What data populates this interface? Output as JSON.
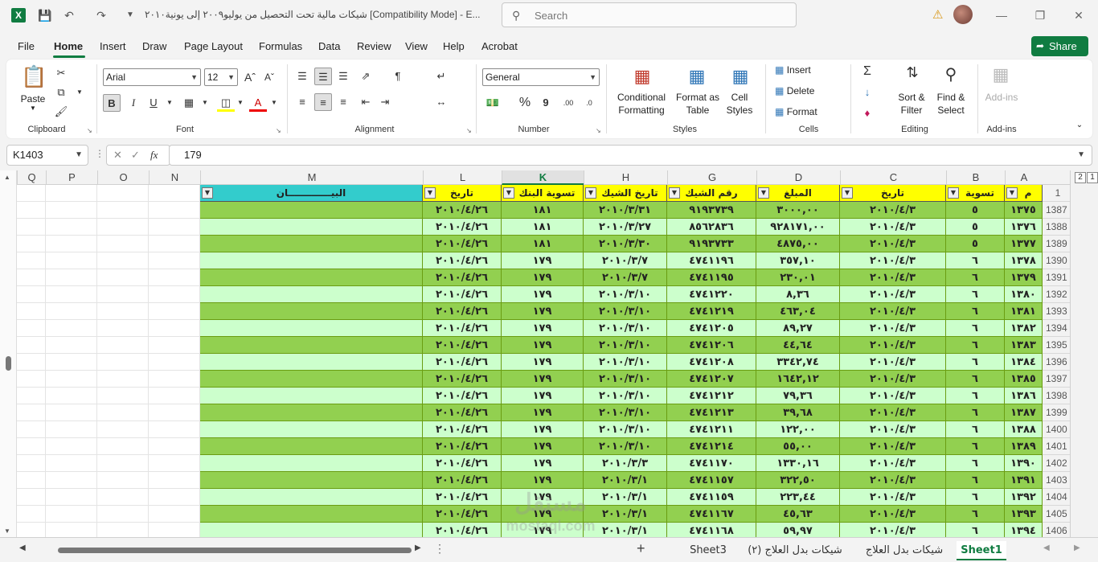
{
  "titlebar": {
    "app_logo": "X",
    "doc_title": "شيكات مالية تحت التحصيل من يوليو٢٠٠٩ إلى يونية٢٠١٠  [Compatibility Mode]  -  E...",
    "search_placeholder": "Search"
  },
  "menu": {
    "items": [
      "File",
      "Home",
      "Insert",
      "Draw",
      "Page Layout",
      "Formulas",
      "Data",
      "Review",
      "View",
      "Help",
      "Acrobat"
    ],
    "share": "Share"
  },
  "ribbon": {
    "clipboard": {
      "paste": "Paste",
      "label": "Clipboard"
    },
    "font": {
      "name": "Arial",
      "size": "12",
      "label": "Font",
      "bold": "B",
      "italic": "I",
      "underline": "U"
    },
    "alignment": {
      "label": "Alignment"
    },
    "number": {
      "format": "General",
      "label": "Number",
      "percent": "%",
      "comma": "9"
    },
    "styles": {
      "conditional": "Conditional",
      "conditional2": "Formatting",
      "format_as": "Format as",
      "table": "Table",
      "cell": "Cell",
      "cell2": "Styles",
      "label": "Styles"
    },
    "cells": {
      "insert": "Insert",
      "delete": "Delete",
      "format": "Format",
      "label": "Cells"
    },
    "editing": {
      "sort": "Sort &",
      "filter": "Filter",
      "find": "Find &",
      "select": "Select",
      "label": "Editing"
    },
    "addins": {
      "button": "Add-ins",
      "label": "Add-ins"
    }
  },
  "formula_bar": {
    "cell_ref": "K1403",
    "value": "179",
    "fx": "fx"
  },
  "columns": [
    "Q",
    "P",
    "O",
    "N",
    "M",
    "L",
    "K",
    "H",
    "G",
    "D",
    "C",
    "B",
    "A"
  ],
  "outline": [
    "2",
    "1"
  ],
  "header_row": {
    "num": "1",
    "m": "البيـــــــــــــان",
    "l": "تاريخ",
    "k": "تسوية البنك",
    "h": "تاريخ الشيك",
    "g": "رقم الشيك",
    "d": "المبلغ",
    "c": "تاريخ",
    "b": "تسوية",
    "a": "م"
  },
  "rows": [
    {
      "num": "1387",
      "l": "٢٠١٠/٤/٢٦",
      "k": "١٨١",
      "h": "٢٠١٠/٣/٣١",
      "g": "٩١٩٣٧٣٩",
      "d": "٣٠٠٠,٠٠",
      "c": "٢٠١٠/٤/٣",
      "b": "٥",
      "a": "١٣٧٥"
    },
    {
      "num": "1388",
      "l": "٢٠١٠/٤/٢٦",
      "k": "١٨١",
      "h": "٢٠١٠/٣/٢٧",
      "g": "٨٥٦٢٨٣٦",
      "d": "٩٢٨١٧١,٠٠",
      "c": "٢٠١٠/٤/٣",
      "b": "٥",
      "a": "١٣٧٦"
    },
    {
      "num": "1389",
      "l": "٢٠١٠/٤/٢٦",
      "k": "١٨١",
      "h": "٢٠١٠/٣/٣٠",
      "g": "٩١٩٣٧٣٣",
      "d": "٤٨٧٥,٠٠",
      "c": "٢٠١٠/٤/٣",
      "b": "٥",
      "a": "١٣٧٧"
    },
    {
      "num": "1390",
      "l": "٢٠١٠/٤/٢٦",
      "k": "١٧٩",
      "h": "٢٠١٠/٣/٧",
      "g": "٤٧٤١١٩٦",
      "d": "٣٥٧,١٠",
      "c": "٢٠١٠/٤/٣",
      "b": "٦",
      "a": "١٣٧٨"
    },
    {
      "num": "1391",
      "l": "٢٠١٠/٤/٢٦",
      "k": "١٧٩",
      "h": "٢٠١٠/٣/٧",
      "g": "٤٧٤١١٩٥",
      "d": "٢٣٠,٠١",
      "c": "٢٠١٠/٤/٣",
      "b": "٦",
      "a": "١٣٧٩"
    },
    {
      "num": "1392",
      "l": "٢٠١٠/٤/٢٦",
      "k": "١٧٩",
      "h": "٢٠١٠/٣/١٠",
      "g": "٤٧٤١٢٢٠",
      "d": "٨,٣٦",
      "c": "٢٠١٠/٤/٣",
      "b": "٦",
      "a": "١٣٨٠"
    },
    {
      "num": "1393",
      "l": "٢٠١٠/٤/٢٦",
      "k": "١٧٩",
      "h": "٢٠١٠/٣/١٠",
      "g": "٤٧٤١٢١٩",
      "d": "٤٦٣,٠٤",
      "c": "٢٠١٠/٤/٣",
      "b": "٦",
      "a": "١٣٨١"
    },
    {
      "num": "1394",
      "l": "٢٠١٠/٤/٢٦",
      "k": "١٧٩",
      "h": "٢٠١٠/٣/١٠",
      "g": "٤٧٤١٢٠٥",
      "d": "٨٩,٢٧",
      "c": "٢٠١٠/٤/٣",
      "b": "٦",
      "a": "١٣٨٢"
    },
    {
      "num": "1395",
      "l": "٢٠١٠/٤/٢٦",
      "k": "١٧٩",
      "h": "٢٠١٠/٣/١٠",
      "g": "٤٧٤١٢٠٦",
      "d": "٤٤,٦٤",
      "c": "٢٠١٠/٤/٣",
      "b": "٦",
      "a": "١٣٨٣"
    },
    {
      "num": "1396",
      "l": "٢٠١٠/٤/٢٦",
      "k": "١٧٩",
      "h": "٢٠١٠/٣/١٠",
      "g": "٤٧٤١٢٠٨",
      "d": "٣٣٤٢,٧٤",
      "c": "٢٠١٠/٤/٣",
      "b": "٦",
      "a": "١٣٨٤"
    },
    {
      "num": "1397",
      "l": "٢٠١٠/٤/٢٦",
      "k": "١٧٩",
      "h": "٢٠١٠/٣/١٠",
      "g": "٤٧٤١٢٠٧",
      "d": "١٦٤٢,١٢",
      "c": "٢٠١٠/٤/٣",
      "b": "٦",
      "a": "١٣٨٥"
    },
    {
      "num": "1398",
      "l": "٢٠١٠/٤/٢٦",
      "k": "١٧٩",
      "h": "٢٠١٠/٣/١٠",
      "g": "٤٧٤١٢١٢",
      "d": "٧٩,٣٦",
      "c": "٢٠١٠/٤/٣",
      "b": "٦",
      "a": "١٣٨٦"
    },
    {
      "num": "1399",
      "l": "٢٠١٠/٤/٢٦",
      "k": "١٧٩",
      "h": "٢٠١٠/٣/١٠",
      "g": "٤٧٤١٢١٣",
      "d": "٣٩,٦٨",
      "c": "٢٠١٠/٤/٣",
      "b": "٦",
      "a": "١٣٨٧"
    },
    {
      "num": "1400",
      "l": "٢٠١٠/٤/٢٦",
      "k": "١٧٩",
      "h": "٢٠١٠/٣/١٠",
      "g": "٤٧٤١٢١١",
      "d": "١٢٢,٠٠",
      "c": "٢٠١٠/٤/٣",
      "b": "٦",
      "a": "١٣٨٨"
    },
    {
      "num": "1401",
      "l": "٢٠١٠/٤/٢٦",
      "k": "١٧٩",
      "h": "٢٠١٠/٣/١٠",
      "g": "٤٧٤١٢١٤",
      "d": "٥٥,٠٠",
      "c": "٢٠١٠/٤/٣",
      "b": "٦",
      "a": "١٣٨٩"
    },
    {
      "num": "1402",
      "l": "٢٠١٠/٤/٢٦",
      "k": "١٧٩",
      "h": "٢٠١٠/٣/٣",
      "g": "٤٧٤١١٧٠",
      "d": "١٣٣٠,١٦",
      "c": "٢٠١٠/٤/٣",
      "b": "٦",
      "a": "١٣٩٠"
    },
    {
      "num": "1403",
      "l": "٢٠١٠/٤/٢٦",
      "k": "١٧٩",
      "h": "٢٠١٠/٣/١",
      "g": "٤٧٤١١٥٧",
      "d": "٣٢٢,٥٠",
      "c": "٢٠١٠/٤/٣",
      "b": "٦",
      "a": "١٣٩١"
    },
    {
      "num": "1404",
      "l": "٢٠١٠/٤/٢٦",
      "k": "١٧٩",
      "h": "٢٠١٠/٣/١",
      "g": "٤٧٤١١٥٩",
      "d": "٢٢٣,٤٤",
      "c": "٢٠١٠/٤/٣",
      "b": "٦",
      "a": "١٣٩٢"
    },
    {
      "num": "1405",
      "l": "٢٠١٠/٤/٢٦",
      "k": "١٧٩",
      "h": "٢٠١٠/٣/١",
      "g": "٤٧٤١١٦٧",
      "d": "٤٥,٦٣",
      "c": "٢٠١٠/٤/٣",
      "b": "٦",
      "a": "١٣٩٣"
    },
    {
      "num": "1406",
      "l": "٢٠١٠/٤/٢٦",
      "k": "١٧٩",
      "h": "٢٠١٠/٣/١",
      "g": "٤٧٤١١٦٨",
      "d": "٥٩,٩٧",
      "c": "٢٠١٠/٤/٣",
      "b": "٦",
      "a": "١٣٩٤"
    }
  ],
  "sheet_tabs": [
    "Sheet3",
    "شيكات بدل العلاج (٢)",
    "شيكات بدل العلاج",
    "Sheet1"
  ],
  "watermark": {
    "line1": "مستقل",
    "line2": "mostaql.com"
  },
  "colors": {
    "dark_green": "#92d050",
    "light_green": "#ccffcc",
    "yellow": "#ffff00",
    "cyan": "#33cccc",
    "accent": "#107c41"
  }
}
